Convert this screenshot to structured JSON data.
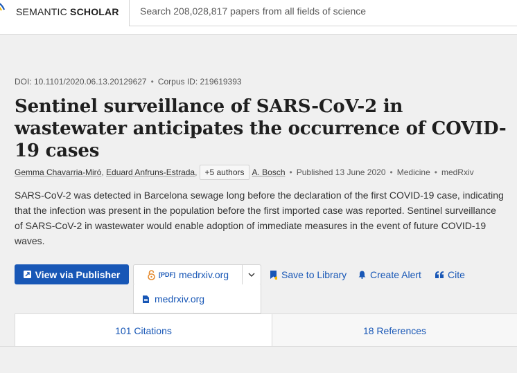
{
  "header": {
    "brand_light": "SEMANTIC ",
    "brand_bold": "SCHOLAR",
    "search_placeholder": "Search 208,028,817 papers from all fields of science"
  },
  "paper": {
    "doi": "DOI: 10.1101/2020.06.13.20129627",
    "corpus_id": "Corpus ID: 219619393",
    "title": "Sentinel surveillance of SARS-CoV-2 in wastewater anticipates the occurrence of COVID-19 cases",
    "authors": [
      "Gemma Chavarria-Miró",
      "Eduard Anfruns-Estrada"
    ],
    "more_authors": "+5 authors",
    "last_author": "A. Bosch",
    "published": "Published 13 June 2020",
    "field": "Medicine",
    "venue": "medRxiv",
    "abstract": "SARS-CoV-2 was detected in Barcelona sewage long before the declaration of the first COVID-19 case, indicating that the infection was present in the population before the first imported case was reported. Sentinel surveillance of SARS-CoV-2 in wastewater would enable adoption of immediate measures in the event of future COVID-19 waves."
  },
  "actions": {
    "view_publisher": "View via Publisher",
    "pdf_tag": "[PDF]",
    "pdf_source": "medrxiv.org",
    "dropdown_item": "medrxiv.org",
    "save_to_library": "Save to Library",
    "create_alert": "Create Alert",
    "cite": "Cite"
  },
  "tabs": {
    "citations": "101 Citations",
    "references": "18 References"
  },
  "colors": {
    "accent": "#1857b6",
    "logo_yellow": "#f5b800",
    "open_access_orange": "#e58a2e"
  },
  "icons": {
    "logo": "semantic-scholar-logo",
    "external": "external-link-icon",
    "open_access": "open-lock-icon",
    "caret": "chevron-down-icon",
    "pdf_file": "pdf-file-icon",
    "bookmark": "bookmark-icon",
    "bell": "bell-icon",
    "quote": "quote-icon"
  }
}
